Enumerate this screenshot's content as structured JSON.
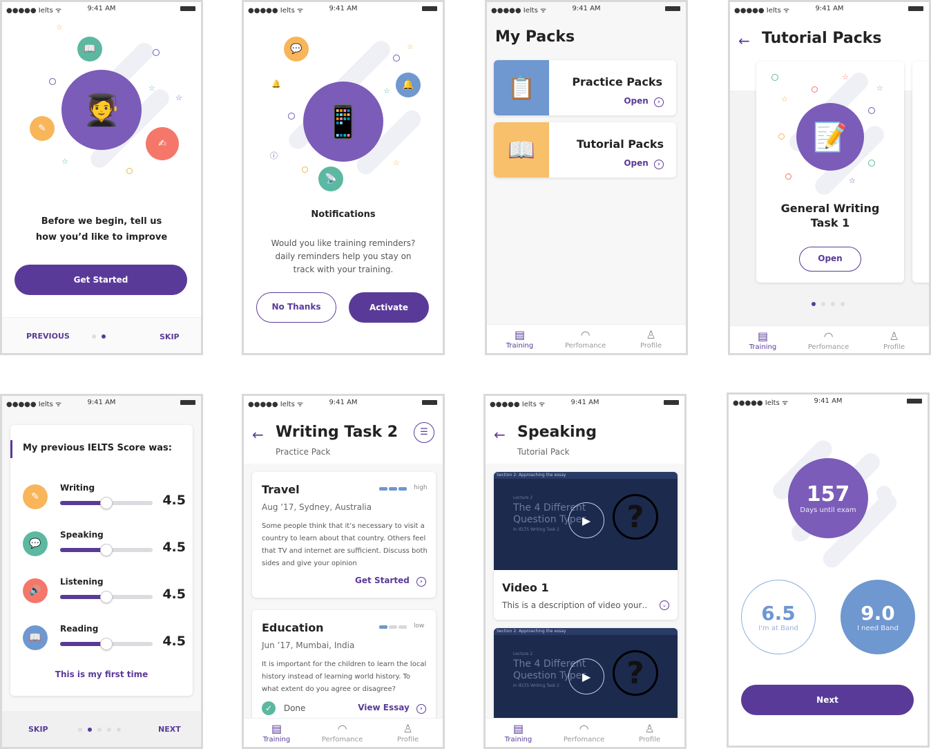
{
  "status": {
    "carrier": "●●●●● Ielts ᯤ",
    "time": "9:41 AM"
  },
  "colors": {
    "primary": "#5a3a98",
    "green": "#5cb8a0",
    "orange": "#f8b55a",
    "coral": "#f4776a",
    "blue": "#6f97d0",
    "purple_circle": "#7b5cb8"
  },
  "screen1": {
    "text_line1": "Before we begin, tell us",
    "text_line2": "how you’d like to improve",
    "button": "Get Started",
    "previous": "PREVIOUS",
    "skip": "SKIP"
  },
  "screen2": {
    "title": "Notifications",
    "body": "Would you like training reminders? daily reminders help you stay on track with your training.",
    "no_thanks": "No Thanks",
    "activate": "Activate"
  },
  "screen3": {
    "title": "My Packs",
    "cards": [
      {
        "title": "Practice Packs",
        "action": "Open"
      },
      {
        "title": "Tutorial Packs",
        "action": "Open"
      }
    ]
  },
  "tabs": {
    "training": "Training",
    "performance": "Perfomance",
    "profile": "Profile"
  },
  "screen4": {
    "title": "Tutorial Packs",
    "card_title_line1": "General Writing",
    "card_title_line2": "Task 1",
    "button": "Open"
  },
  "screen5": {
    "heading": "My previous IELTS Score was:",
    "skills": [
      {
        "name": "Writing",
        "score": "4.5",
        "progress": 0.5
      },
      {
        "name": "Speaking",
        "score": "4.5",
        "progress": 0.5
      },
      {
        "name": "Listening",
        "score": "4.5",
        "progress": 0.5
      },
      {
        "name": "Reading",
        "score": "4.5",
        "progress": 0.5
      }
    ],
    "first_time": "This is my first time",
    "skip": "SKIP",
    "next": "NEXT"
  },
  "screen6": {
    "title": "Writing Task 2",
    "subtitle": "Practice Pack",
    "essays": [
      {
        "title": "Travel",
        "level": "high",
        "meta": "Aug ’17, Sydney, Australia",
        "body": "Some people think that it’s necessary to visit a country to learn about that country. Others feel that TV and internet are sufficient. Discuss both sides and give your opinion",
        "action": "Get Started"
      },
      {
        "title": "Education",
        "level": "low",
        "meta": "Jun ’17, Mumbai, India",
        "body": "It is important for the children to learn the local history instead of learning world history. To what extent do you agree or disagree?",
        "status": "Done",
        "action": "View Essay"
      }
    ]
  },
  "screen7": {
    "title": "Speaking",
    "subtitle": "Tutorial Pack",
    "video_header": "Section 2: Approaching the essay",
    "video_lecture": "Lecture 2",
    "video_heading_line1": "The 4 Different",
    "video_heading_line2": "Question Types",
    "video_caption": "In IELTS Writing Task 2",
    "video_title": "Video 1",
    "video_desc": "This is a description of video your…"
  },
  "screen8": {
    "days": "157",
    "days_label": "Days until exam",
    "current_band": "6.5",
    "current_label": "I'm at Band",
    "target_band": "9.0",
    "target_label": "I need Band",
    "button": "Next"
  }
}
